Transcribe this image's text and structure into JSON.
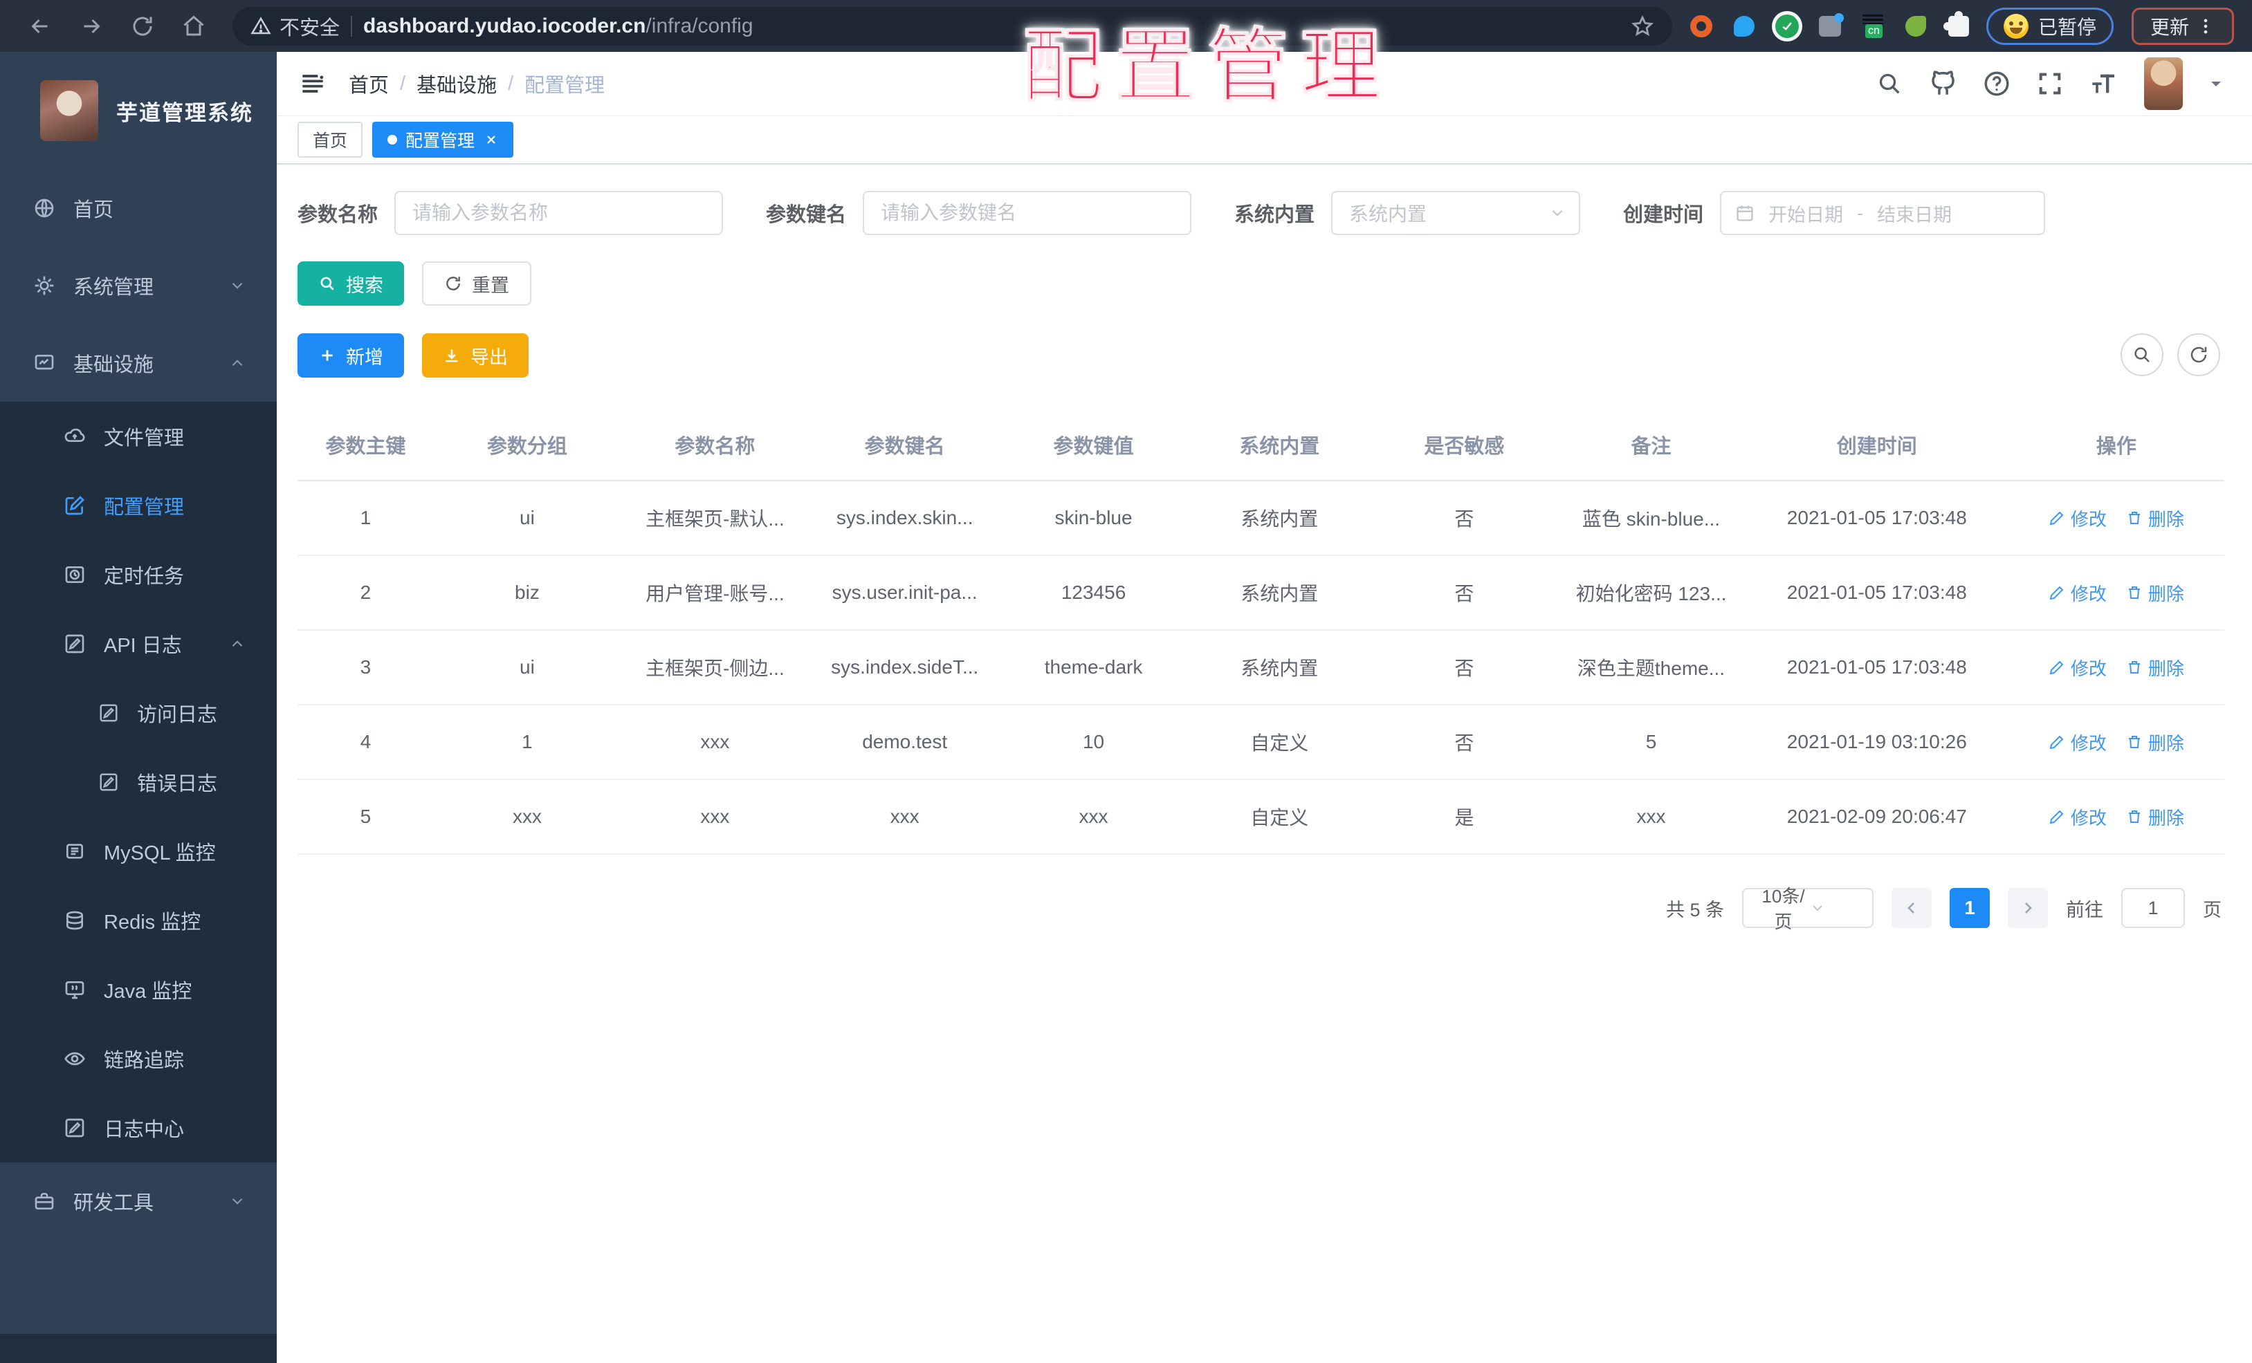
{
  "browser": {
    "security_label": "不安全",
    "url_host": "dashboard.yudao.iocoder.cn",
    "url_path": "/infra/config",
    "cn_badge": "cn",
    "paused_badge": "已暂停",
    "update_label": "更新"
  },
  "overlay_title": "配置管理",
  "sidebar": {
    "app_title": "芋道管理系统",
    "items": [
      {
        "label": "首页"
      },
      {
        "label": "系统管理"
      },
      {
        "label": "基础设施"
      },
      {
        "label": "文件管理"
      },
      {
        "label": "配置管理"
      },
      {
        "label": "定时任务"
      },
      {
        "label": "API 日志"
      },
      {
        "label": "访问日志"
      },
      {
        "label": "错误日志"
      },
      {
        "label": "MySQL 监控"
      },
      {
        "label": "Redis 监控"
      },
      {
        "label": "Java 监控"
      },
      {
        "label": "链路追踪"
      },
      {
        "label": "日志中心"
      },
      {
        "label": "研发工具"
      }
    ]
  },
  "header": {
    "breadcrumb": [
      "首页",
      "基础设施",
      "配置管理"
    ],
    "breadcrumb_separator": "/"
  },
  "tabs": [
    {
      "label": "首页"
    },
    {
      "label": "配置管理"
    }
  ],
  "filters": {
    "name": {
      "label": "参数名称",
      "placeholder": "请输入参数名称"
    },
    "key": {
      "label": "参数键名",
      "placeholder": "请输入参数键名"
    },
    "type": {
      "label": "系统内置",
      "placeholder": "系统内置"
    },
    "date": {
      "label": "创建时间",
      "start_placeholder": "开始日期",
      "separator": "-",
      "end_placeholder": "结束日期"
    }
  },
  "toolbar": {
    "search_label": "搜索",
    "reset_label": "重置",
    "add_label": "新增",
    "export_label": "导出"
  },
  "table": {
    "headers": [
      "参数主键",
      "参数分组",
      "参数名称",
      "参数键名",
      "参数键值",
      "系统内置",
      "是否敏感",
      "备注",
      "创建时间",
      "操作"
    ],
    "edit_label": "修改",
    "delete_label": "删除",
    "rows": [
      [
        "1",
        "ui",
        "主框架页-默认...",
        "sys.index.skin...",
        "skin-blue",
        "系统内置",
        "否",
        "蓝色 skin-blue...",
        "2021-01-05 17:03:48"
      ],
      [
        "2",
        "biz",
        "用户管理-账号...",
        "sys.user.init-pa...",
        "123456",
        "系统内置",
        "否",
        "初始化密码 123...",
        "2021-01-05 17:03:48"
      ],
      [
        "3",
        "ui",
        "主框架页-侧边...",
        "sys.index.sideT...",
        "theme-dark",
        "系统内置",
        "否",
        "深色主题theme...",
        "2021-01-05 17:03:48"
      ],
      [
        "4",
        "1",
        "xxx",
        "demo.test",
        "10",
        "自定义",
        "否",
        "5",
        "2021-01-19 03:10:26"
      ],
      [
        "5",
        "xxx",
        "xxx",
        "xxx",
        "xxx",
        "自定义",
        "是",
        "xxx",
        "2021-02-09 20:06:47"
      ]
    ]
  },
  "pagination": {
    "total": "共 5 条",
    "page_size": "10条/页",
    "current_page": "1",
    "goto_label": "前往",
    "goto_value": "1",
    "page_suffix": "页"
  },
  "colors": {
    "accent_blue": "#409eff",
    "active_tab_blue": "#1e8cf7",
    "search_teal": "#15b1a2",
    "add_blue": "#1e8af5",
    "export_orange": "#f5ab0b",
    "sidebar_bg": "#304156",
    "submenu_bg": "#1f2d3d",
    "overlay_red": "#ee2b52",
    "chrome_bg": "#27313f"
  }
}
